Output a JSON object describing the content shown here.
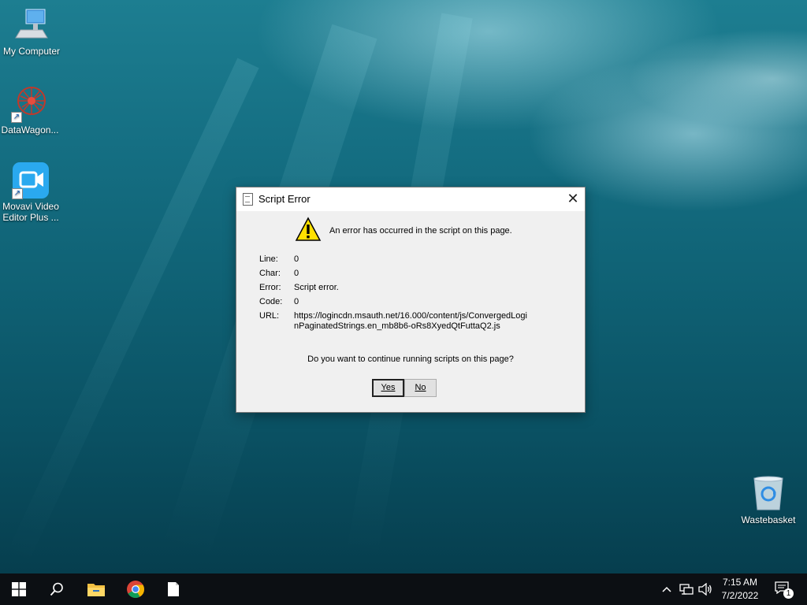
{
  "desktop": {
    "icons": [
      {
        "label": "My Computer",
        "icon": "computer-icon"
      },
      {
        "label": "DataWagon...",
        "icon": "datawagon-icon"
      },
      {
        "label": "Movavi Video Editor Plus ...",
        "icon": "movavi-icon"
      },
      {
        "label": "Wastebasket",
        "icon": "recycle-bin-icon"
      }
    ]
  },
  "dialog": {
    "title": "Script Error",
    "message": "An error has occurred in the script on this page.",
    "fields": {
      "line_label": "Line:",
      "line_value": "0",
      "char_label": "Char:",
      "char_value": "0",
      "error_label": "Error:",
      "error_value": "Script error.",
      "code_label": "Code:",
      "code_value": "0",
      "url_label": "URL:",
      "url_value": "https://logincdn.msauth.net/16.000/content/js/ConvergedLoginPaginatedStrings.en_mb8b6-oRs8XyedQtFuttaQ2.js"
    },
    "question": "Do you want to continue running scripts on this page?",
    "yes_label": "Yes",
    "no_label": "No",
    "close_glyph": "✕"
  },
  "taskbar": {
    "time": "7:15 AM",
    "date": "7/2/2022",
    "notification_count": "1",
    "colors": {
      "background": "#0c0f13",
      "folder": "#f3c042"
    }
  }
}
